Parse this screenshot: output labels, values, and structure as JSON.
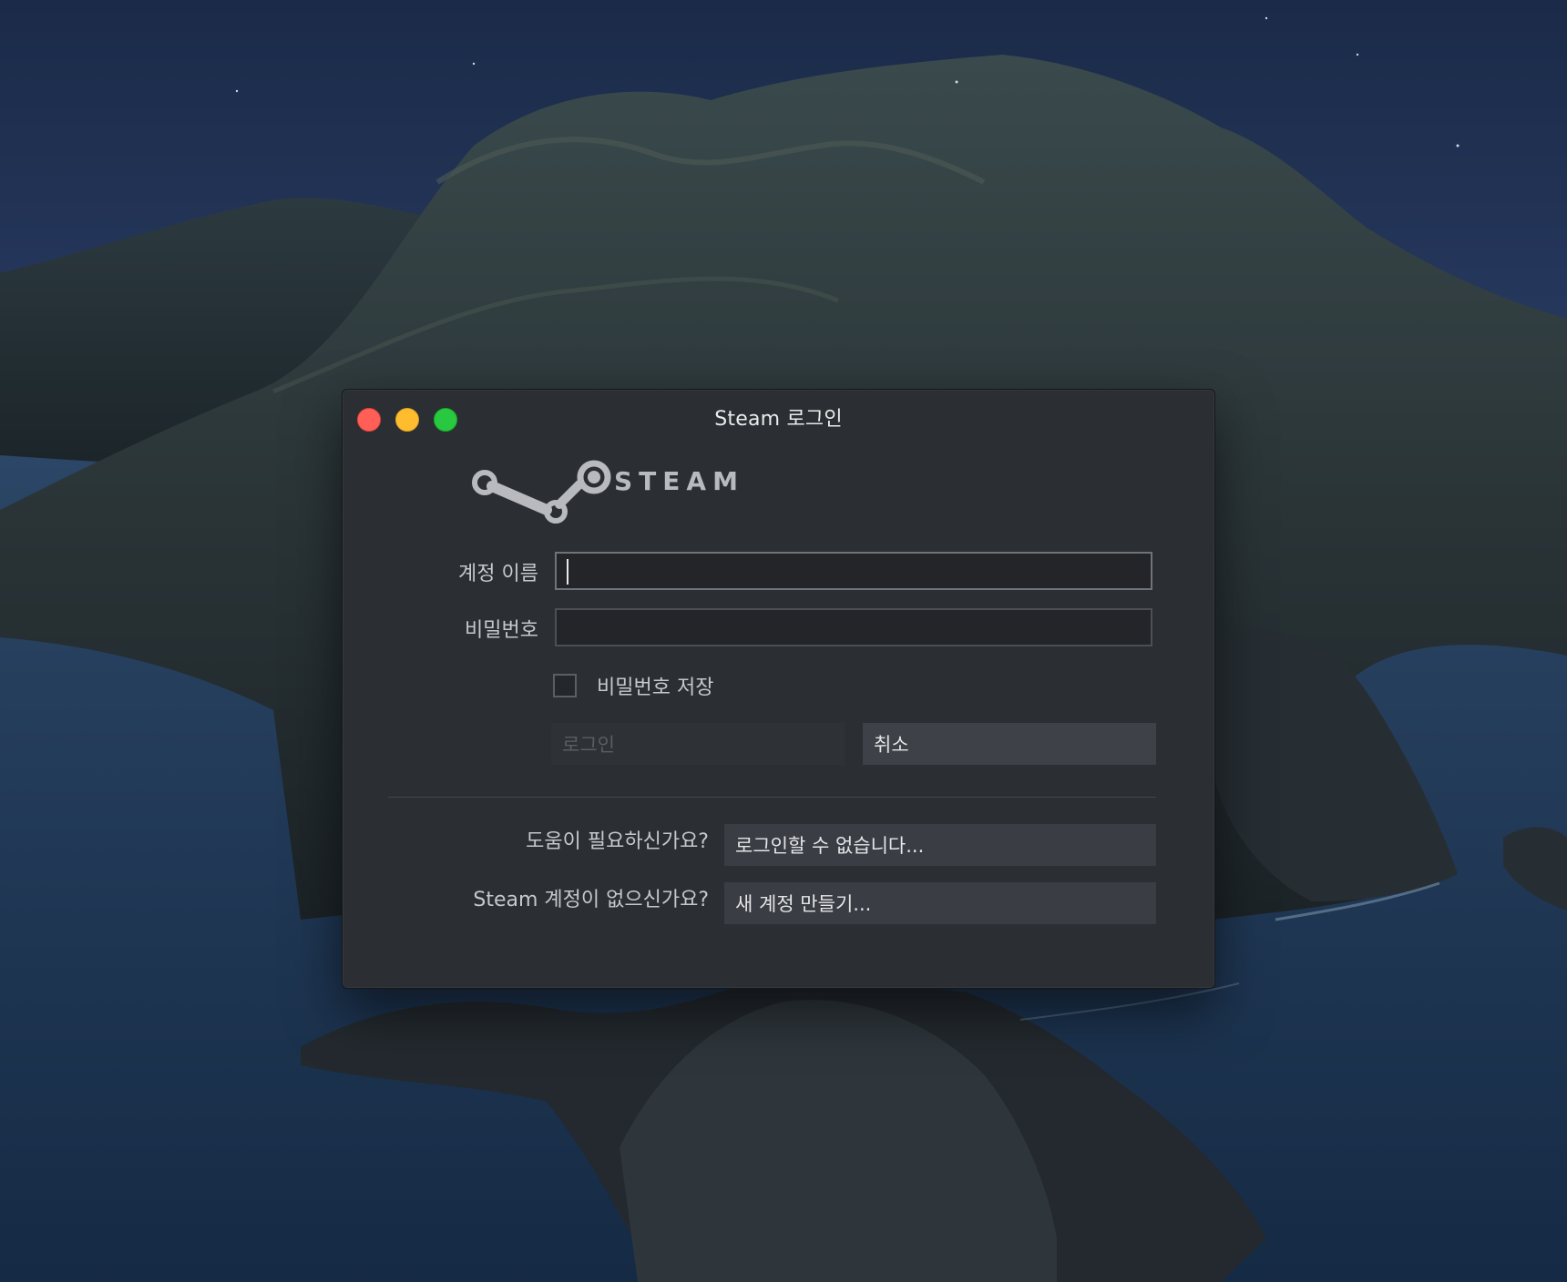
{
  "window": {
    "title": "Steam 로그인"
  },
  "brand": {
    "wordmark": "STEAM",
    "mark": "steam-logo"
  },
  "form": {
    "account_label": "계정 이름",
    "account_value": "",
    "password_label": "비밀번호",
    "password_value": "",
    "remember_label": "비밀번호 저장",
    "remember_checked": false
  },
  "buttons": {
    "login": "로그인",
    "cancel": "취소"
  },
  "help": {
    "need_help_label": "도움이 필요하신가요?",
    "cant_login_button": "로그인할 수 없습니다...",
    "no_account_label": "Steam 계정이 없으신가요?",
    "create_account_button": "새 계정 만들기..."
  },
  "colors": {
    "window_bg": "#2b2e33",
    "close": "#ff5f57",
    "minimize": "#febc2e",
    "maximize": "#28c840"
  }
}
